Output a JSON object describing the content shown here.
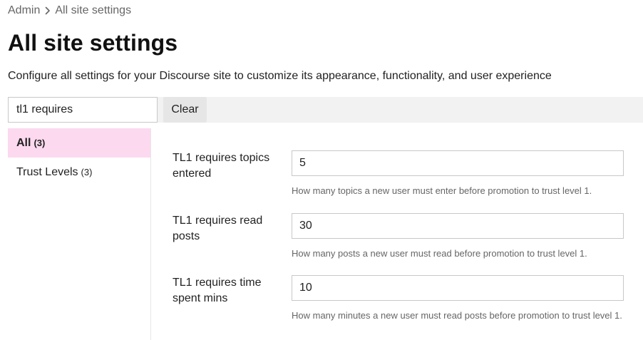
{
  "breadcrumb": {
    "root": "Admin",
    "current": "All site settings"
  },
  "header": {
    "title": "All site settings",
    "description": "Configure all settings for your Discourse site to customize its appearance, functionality, and user experience"
  },
  "filter": {
    "search_value": "tl1 requires",
    "clear_label": "Clear"
  },
  "sidebar": {
    "items": [
      {
        "label": "All",
        "count": "(3)",
        "active": true
      },
      {
        "label": "Trust Levels",
        "count": "(3)",
        "active": false
      }
    ]
  },
  "settings": [
    {
      "label": "TL1 requires topics entered",
      "value": "5",
      "description": "How many topics a new user must enter before promotion to trust level 1."
    },
    {
      "label": "TL1 requires read posts",
      "value": "30",
      "description": "How many posts a new user must read before promotion to trust level 1."
    },
    {
      "label": "TL1 requires time spent mins",
      "value": "10",
      "description": "How many minutes a new user must read posts before promotion to trust level 1."
    }
  ],
  "colors": {
    "active_category_bg": "#fcd9ef",
    "filter_bar_bg": "#f2f2f2",
    "muted_text": "#666666"
  },
  "icons": {
    "breadcrumb_separator": "chevron-right-icon"
  }
}
